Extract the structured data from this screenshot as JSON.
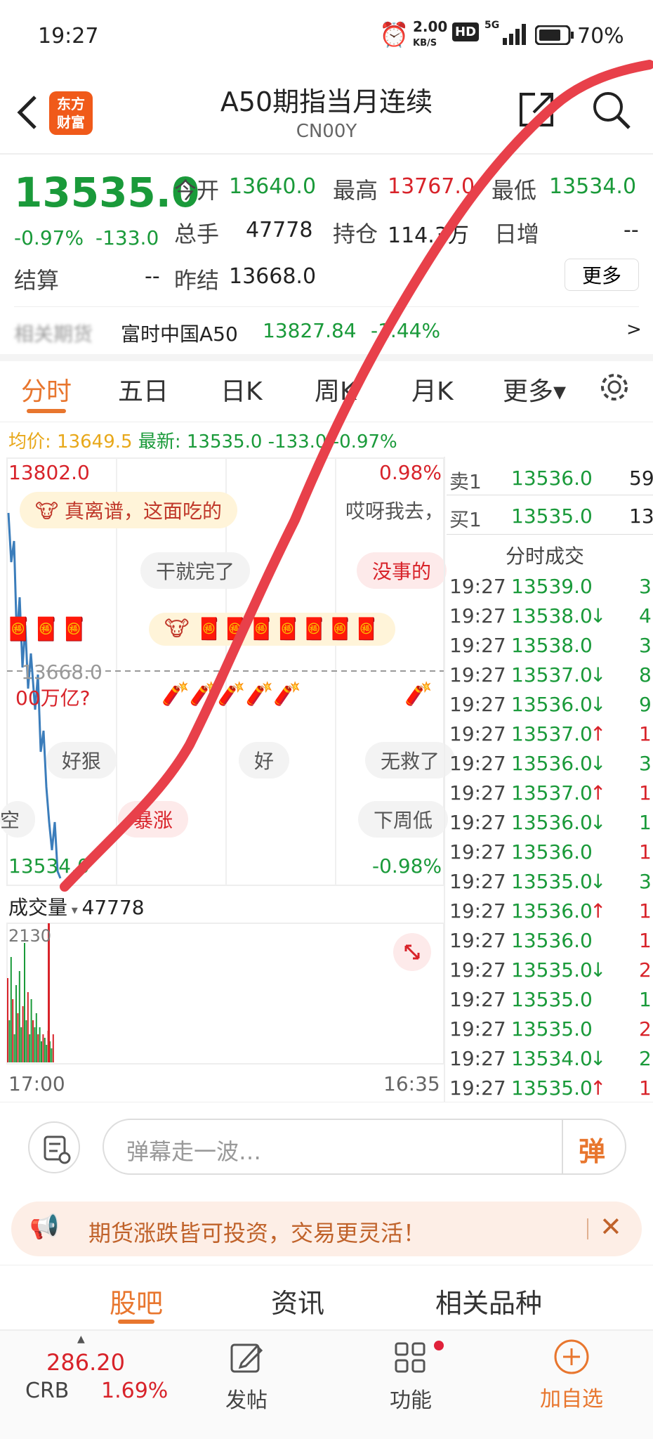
{
  "status_bar": {
    "time": "19:27",
    "net_speed": "2.00",
    "net_unit": "KB/S",
    "hd": "HD",
    "signal": "5G",
    "battery": "70%"
  },
  "header": {
    "logo_line1": "东方",
    "logo_line2": "财富",
    "title": "A50期指当月连续",
    "code": "CN00Y"
  },
  "quote": {
    "price": "13535.0",
    "change_pct": "-0.97%",
    "change_abs": "-133.0",
    "open_label": "今开",
    "open": "13640.0",
    "high_label": "最高",
    "high": "13767.0",
    "low_label": "最低",
    "low": "13534.0",
    "volume_label": "总手",
    "volume": "47778",
    "oi_label": "持仓",
    "oi": "114.3万",
    "daily_inc_label": "日增",
    "daily_inc": "--",
    "settle_label": "结算",
    "settle": "--",
    "prev_settle_label": "昨结",
    "prev_settle": "13668.0",
    "more_button": "更多"
  },
  "related": {
    "prefix": "相关期货",
    "name": "富时中国A50",
    "price": "13827.84",
    "change": "-1.44%",
    "arrow": ">"
  },
  "tabs": [
    "分时",
    "五日",
    "日K",
    "周K",
    "月K",
    "更多▾"
  ],
  "avg_line": {
    "avg_label": "均价:",
    "avg": "13649.5",
    "last_label": "最新:",
    "last": "13535.0",
    "chg": "-133.0",
    "pct": "-0.97%"
  },
  "chart": {
    "top_price": "13802.0",
    "top_pct": "0.98%",
    "mid_price": "13668.0",
    "bottom_price": "13534.0",
    "bottom_pct": "-0.98%",
    "volume_label": "成交量",
    "volume_value": "47778",
    "vol_max": "2130",
    "time_start": "17:00",
    "time_end": "16:35"
  },
  "danmaku": [
    "真离谱，这面吃的",
    "哎呀我去，",
    "干就完了",
    "没事的",
    "00万亿?",
    "好狠",
    "好",
    "无救了",
    "空",
    "暴涨",
    "下周低"
  ],
  "orderbook": {
    "sell_label": "卖1",
    "sell_price": "13536.0",
    "sell_qty": "59",
    "buy_label": "买1",
    "buy_price": "13535.0",
    "buy_qty": "13"
  },
  "trades_title": "分时成交",
  "trades": [
    {
      "t": "19:27",
      "p": "13539.0",
      "a": "",
      "q": "3",
      "c": "green"
    },
    {
      "t": "19:27",
      "p": "13538.0",
      "a": "↓",
      "q": "4",
      "c": "green"
    },
    {
      "t": "19:27",
      "p": "13538.0",
      "a": "",
      "q": "3",
      "c": "green"
    },
    {
      "t": "19:27",
      "p": "13537.0",
      "a": "↓",
      "q": "8",
      "c": "green"
    },
    {
      "t": "19:27",
      "p": "13536.0",
      "a": "↓",
      "q": "9",
      "c": "green"
    },
    {
      "t": "19:27",
      "p": "13537.0",
      "a": "↑",
      "q": "1",
      "c": "red"
    },
    {
      "t": "19:27",
      "p": "13536.0",
      "a": "↓",
      "q": "3",
      "c": "green"
    },
    {
      "t": "19:27",
      "p": "13537.0",
      "a": "↑",
      "q": "1",
      "c": "red"
    },
    {
      "t": "19:27",
      "p": "13536.0",
      "a": "↓",
      "q": "1",
      "c": "green"
    },
    {
      "t": "19:27",
      "p": "13536.0",
      "a": "",
      "q": "1",
      "c": "red"
    },
    {
      "t": "19:27",
      "p": "13535.0",
      "a": "↓",
      "q": "3",
      "c": "green"
    },
    {
      "t": "19:27",
      "p": "13536.0",
      "a": "↑",
      "q": "1",
      "c": "red"
    },
    {
      "t": "19:27",
      "p": "13536.0",
      "a": "",
      "q": "1",
      "c": "red"
    },
    {
      "t": "19:27",
      "p": "13535.0",
      "a": "↓",
      "q": "2",
      "c": "red"
    },
    {
      "t": "19:27",
      "p": "13535.0",
      "a": "",
      "q": "1",
      "c": "green"
    },
    {
      "t": "19:27",
      "p": "13535.0",
      "a": "",
      "q": "2",
      "c": "red"
    },
    {
      "t": "19:27",
      "p": "13534.0",
      "a": "↓",
      "q": "2",
      "c": "green"
    },
    {
      "t": "19:27",
      "p": "13535.0",
      "a": "↑",
      "q": "1",
      "c": "red"
    }
  ],
  "comment_bar": {
    "placeholder": "弹幕走一波…",
    "danmaku_btn": "弹"
  },
  "promo": {
    "text": "期货涨跌皆可投资，交易更灵活！"
  },
  "bottom_tabs": [
    "股吧",
    "资讯",
    "相关品种"
  ],
  "bottom_nav": {
    "crb_value": "286.20",
    "crb_label": "CRB",
    "crb_pct": "1.69%",
    "post": "发帖",
    "func": "功能",
    "add": "加自选"
  },
  "colors": {
    "up": "#d8232a",
    "down": "#1a9a3a",
    "accent": "#e8762e"
  }
}
